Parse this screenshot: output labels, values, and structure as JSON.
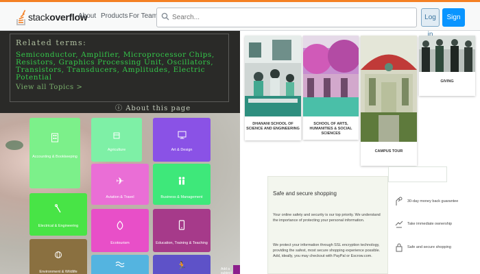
{
  "header": {
    "logo_text_light": "stack",
    "logo_text_bold": "overflow",
    "nav": [
      "About",
      "Products",
      "For Teams"
    ],
    "search_placeholder": "Search...",
    "login_label": "Log in",
    "signup_label": "Sign up",
    "accent": "#f48024"
  },
  "related": {
    "title": "Related terms:",
    "terms": "Semiconductor, Amplifier, Microprocessor Chips, Resistors, Graphics Processing Unit, Oscillators, Transistors, Transducers, Amplitudes, Electric Potential",
    "view_all": "View all Topics  >",
    "about": "About this page"
  },
  "tiles": [
    {
      "label": "Accounting & Bookkeeping",
      "color": "#7cf08a",
      "icon": "building-icon"
    },
    {
      "label": "Agriculture",
      "color": "#7ef0a6",
      "icon": "farm-icon"
    },
    {
      "label": "Art & Design",
      "color": "#8a52e6",
      "icon": "monitor-icon"
    },
    {
      "label": "Aviation & Travel",
      "color": "#ea6ed6",
      "icon": "airplane-icon"
    },
    {
      "label": "Business & Management",
      "color": "#3ee87a",
      "icon": "people-icon"
    },
    {
      "label": "Electrical & Engineering",
      "color": "#48e446",
      "icon": "tools-icon"
    },
    {
      "label": "Ecotourism",
      "color": "#e84fc8",
      "icon": "leaf-icon"
    },
    {
      "label": "Education, Training & Teaching",
      "color": "#a63a8a",
      "icon": "phone-icon"
    },
    {
      "label": "Environment & Wildlife",
      "color": "#8a7040",
      "icon": "globe-icon"
    },
    {
      "label": "",
      "color": "#54b4e0",
      "icon": "wave-icon"
    },
    {
      "label": "",
      "color": "#5e52c8",
      "icon": "runner-icon"
    }
  ],
  "side_strip_label": "Add a subject",
  "gallery": [
    {
      "caption": "DHANANI SCHOOL OF SCIENCE AND ENGINEERING"
    },
    {
      "caption": "SCHOOL OF ARTS, HUMANITIES & SOCIAL SCIENCES"
    },
    {
      "caption": "CAMPUS TOUR"
    },
    {
      "caption": "GIVING"
    }
  ],
  "shopping": {
    "title": "Safe and secure shopping",
    "p1": "Your online safety and security is our top priority. We understand the importance of protecting your personal information.",
    "p2": "We protect your information through SSL encryption technology, providing the safest, most secure shopping experience possible. Add, ideally, you may checkout with PayPal or Escrow.com."
  },
  "features": [
    {
      "label": "30-day money back guarantee",
      "icon": "hand-money-icon"
    },
    {
      "label": "Take immediate ownership",
      "icon": "transfer-icon"
    },
    {
      "label": "Safe and secure shopping",
      "icon": "secure-payment-icon"
    }
  ]
}
